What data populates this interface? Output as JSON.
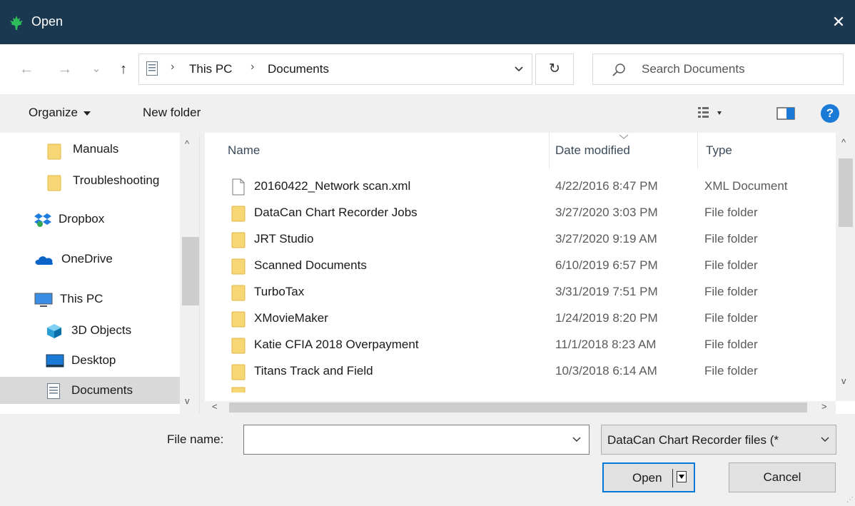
{
  "window": {
    "title": "Open",
    "close_glyph": "✕",
    "accent": "#1a3850"
  },
  "nav": {
    "back_glyph": "←",
    "forward_glyph": "→",
    "recent_glyph": "⌄",
    "up_glyph": "↑",
    "breadcrumb": [
      "This PC",
      "Documents"
    ],
    "refresh_glyph": "↻",
    "search_placeholder": "Search Documents"
  },
  "toolbar": {
    "organize_label": "Organize",
    "new_folder_label": "New folder",
    "help_glyph": "?"
  },
  "sidebar": {
    "items": [
      {
        "label": "Manuals",
        "icon": "folder-icon"
      },
      {
        "label": "Troubleshooting",
        "icon": "folder-icon"
      },
      {
        "label": "Dropbox",
        "icon": "dropbox-icon"
      },
      {
        "label": "OneDrive",
        "icon": "onedrive-icon"
      },
      {
        "label": "This PC",
        "icon": "computer-icon"
      },
      {
        "label": "3D Objects",
        "icon": "3d-objects-icon"
      },
      {
        "label": "Desktop",
        "icon": "desktop-icon"
      },
      {
        "label": "Documents",
        "icon": "documents-icon",
        "selected": true
      }
    ]
  },
  "files": {
    "columns": [
      "Name",
      "Date modified",
      "Type"
    ],
    "rows": [
      {
        "name": "20160422_Network scan.xml",
        "date": "4/22/2016 8:47 PM",
        "type": "XML Document",
        "icon": "file-icon"
      },
      {
        "name": "DataCan Chart Recorder Jobs",
        "date": "3/27/2020 3:03 PM",
        "type": "File folder",
        "icon": "folder-icon"
      },
      {
        "name": "JRT Studio",
        "date": "3/27/2020 9:19 AM",
        "type": "File folder",
        "icon": "folder-icon"
      },
      {
        "name": "Scanned Documents",
        "date": "6/10/2019 6:57 PM",
        "type": "File folder",
        "icon": "folder-icon"
      },
      {
        "name": "TurboTax",
        "date": "3/31/2019 7:51 PM",
        "type": "File folder",
        "icon": "folder-icon"
      },
      {
        "name": "XMovieMaker",
        "date": "1/24/2019 8:20 PM",
        "type": "File folder",
        "icon": "folder-icon"
      },
      {
        "name": "Katie CFIA 2018 Overpayment",
        "date": "11/1/2018 8:23 AM",
        "type": "File folder",
        "icon": "folder-icon"
      },
      {
        "name": "Titans Track and Field",
        "date": "10/3/2018 6:14 AM",
        "type": "File folder",
        "icon": "folder-icon"
      }
    ]
  },
  "bottom": {
    "file_name_label": "File name:",
    "file_name_value": "",
    "filter_value": "DataCan Chart Recorder files (*",
    "open_label": "Open",
    "cancel_label": "Cancel"
  }
}
